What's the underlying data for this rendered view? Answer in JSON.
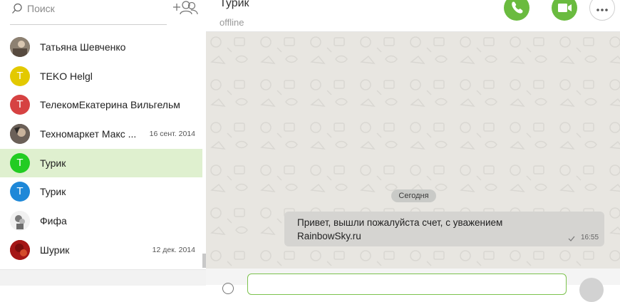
{
  "sidebar": {
    "search": {
      "placeholder": "Поиск",
      "icon": "search-icon"
    },
    "add_contact_icon": "add-contact-icon",
    "contacts": [
      {
        "name": "Татьяна Шевченко",
        "date": "",
        "avatar_letter": "",
        "avatar_color": "#7a6a5e",
        "avatar_type": "photo"
      },
      {
        "name": "TEKO Helgl",
        "date": "",
        "avatar_letter": "T",
        "avatar_color": "#e3c900",
        "avatar_type": "letter"
      },
      {
        "name": "ТелекомЕкатерина Вильгельм",
        "date": "",
        "avatar_letter": "T",
        "avatar_color": "#d64242",
        "avatar_type": "letter"
      },
      {
        "name": "Техномаркет Макс ...",
        "date": "16 сент. 2014",
        "avatar_letter": "",
        "avatar_color": "#5a5048",
        "avatar_type": "photo"
      },
      {
        "name": "Турик",
        "date": "",
        "avatar_letter": "T",
        "avatar_color": "#22cc22",
        "avatar_type": "letter",
        "active": true
      },
      {
        "name": "Турик",
        "date": "",
        "avatar_letter": "T",
        "avatar_color": "#1e88d8",
        "avatar_type": "letter"
      },
      {
        "name": "Фифа",
        "date": "",
        "avatar_letter": "",
        "avatar_color": "#9a9a9a",
        "avatar_type": "photo"
      },
      {
        "name": "Шурик",
        "date": "12 дек. 2014",
        "avatar_letter": "",
        "avatar_color": "#b01c1c",
        "avatar_type": "photo"
      }
    ]
  },
  "chat": {
    "title": "Турик",
    "status": "offline",
    "accent_color": "#6abb3f",
    "actions": [
      "phone-icon",
      "video-icon",
      "more-icon"
    ],
    "date_separator": "Сегодня",
    "message": {
      "line1": "Привет, вышли пожалуйста счет, с уважением",
      "line2": "RainbowSky.ru",
      "time": "16:55",
      "status_icon": "check-icon"
    },
    "input": {
      "value": "",
      "placeholder": ""
    }
  }
}
